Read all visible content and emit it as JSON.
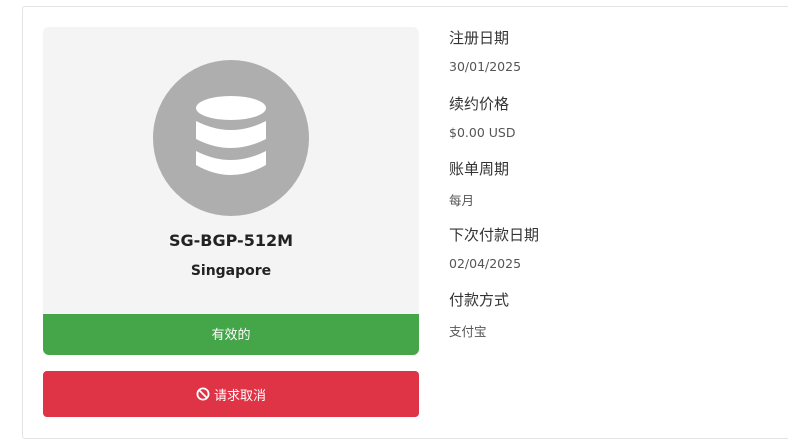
{
  "product": {
    "name": "SG-BGP-512M",
    "location": "Singapore",
    "icon": "database-icon",
    "status": "有效的",
    "status_color": "#45a549"
  },
  "actions": {
    "cancel_label": "请求取消",
    "cancel_icon": "ban-icon",
    "cancel_color": "#df3346"
  },
  "details": {
    "registration_date": {
      "label": "注册日期",
      "value": "30/01/2025"
    },
    "renewal_price": {
      "label": "续约价格",
      "value": "$0.00 USD"
    },
    "billing_cycle": {
      "label": "账单周期",
      "value": "每月"
    },
    "next_due_date": {
      "label": "下次付款日期",
      "value": "02/04/2025"
    },
    "payment_method": {
      "label": "付款方式",
      "value": "支付宝"
    }
  }
}
